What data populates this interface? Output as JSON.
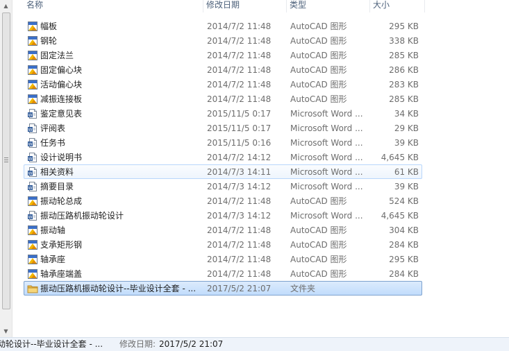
{
  "columns": {
    "name": "名称",
    "date": "修改日期",
    "type": "类型",
    "size": "大小"
  },
  "files": [
    {
      "name": "幅板",
      "date": "2014/7/2 11:48",
      "type": "AutoCAD 图形",
      "size": "295 KB",
      "icon": "autocad-icon"
    },
    {
      "name": "钢轮",
      "date": "2014/7/2 11:48",
      "type": "AutoCAD 图形",
      "size": "338 KB",
      "icon": "autocad-icon"
    },
    {
      "name": "固定法兰",
      "date": "2014/7/2 11:48",
      "type": "AutoCAD 图形",
      "size": "285 KB",
      "icon": "autocad-icon"
    },
    {
      "name": "固定偏心块",
      "date": "2014/7/2 11:48",
      "type": "AutoCAD 图形",
      "size": "286 KB",
      "icon": "autocad-icon"
    },
    {
      "name": "活动偏心块",
      "date": "2014/7/2 11:48",
      "type": "AutoCAD 图形",
      "size": "283 KB",
      "icon": "autocad-icon"
    },
    {
      "name": "减振连接板",
      "date": "2014/7/2 11:48",
      "type": "AutoCAD 图形",
      "size": "285 KB",
      "icon": "autocad-icon"
    },
    {
      "name": "鉴定意见表",
      "date": "2015/11/5 0:17",
      "type": "Microsoft Word ...",
      "size": "34 KB",
      "icon": "word-icon"
    },
    {
      "name": "评阅表",
      "date": "2015/11/5 0:17",
      "type": "Microsoft Word ...",
      "size": "29 KB",
      "icon": "word-icon"
    },
    {
      "name": "任务书",
      "date": "2015/11/5 0:16",
      "type": "Microsoft Word ...",
      "size": "39 KB",
      "icon": "word-icon"
    },
    {
      "name": "设计说明书",
      "date": "2014/7/2 14:12",
      "type": "Microsoft Word ...",
      "size": "4,645 KB",
      "icon": "word-icon"
    },
    {
      "name": "相关资料",
      "date": "2014/7/3 14:11",
      "type": "Microsoft Word ...",
      "size": "61 KB",
      "icon": "word-icon",
      "state": "hover"
    },
    {
      "name": "摘要目录",
      "date": "2014/7/3 14:12",
      "type": "Microsoft Word ...",
      "size": "39 KB",
      "icon": "word-icon"
    },
    {
      "name": "振动轮总成",
      "date": "2014/7/2 11:48",
      "type": "AutoCAD 图形",
      "size": "524 KB",
      "icon": "autocad-icon"
    },
    {
      "name": "振动压路机振动轮设计",
      "date": "2014/7/3 14:12",
      "type": "Microsoft Word ...",
      "size": "4,645 KB",
      "icon": "word-icon"
    },
    {
      "name": "振动轴",
      "date": "2014/7/2 11:48",
      "type": "AutoCAD 图形",
      "size": "304 KB",
      "icon": "autocad-icon"
    },
    {
      "name": "支承矩形钢",
      "date": "2014/7/2 11:48",
      "type": "AutoCAD 图形",
      "size": "284 KB",
      "icon": "autocad-icon"
    },
    {
      "name": "轴承座",
      "date": "2014/7/2 11:48",
      "type": "AutoCAD 图形",
      "size": "295 KB",
      "icon": "autocad-icon"
    },
    {
      "name": "轴承座端盖",
      "date": "2014/7/2 11:48",
      "type": "AutoCAD 图形",
      "size": "284 KB",
      "icon": "autocad-icon"
    },
    {
      "name": "振动压路机振动轮设计--毕业设计全套 - ...",
      "date": "2017/5/2 21:07",
      "type": "文件夹",
      "size": "",
      "icon": "folder-icon",
      "state": "selected"
    }
  ],
  "status": {
    "name": "动轮设计--毕业设计全套 - ...",
    "label": "修改日期:",
    "value": "2017/5/2 21:07"
  },
  "colors": {
    "header_text": "#4c607a",
    "hover_border": "#b8d6fb",
    "selected_border": "#7da2ce",
    "status_bg": "#eef3fa"
  }
}
